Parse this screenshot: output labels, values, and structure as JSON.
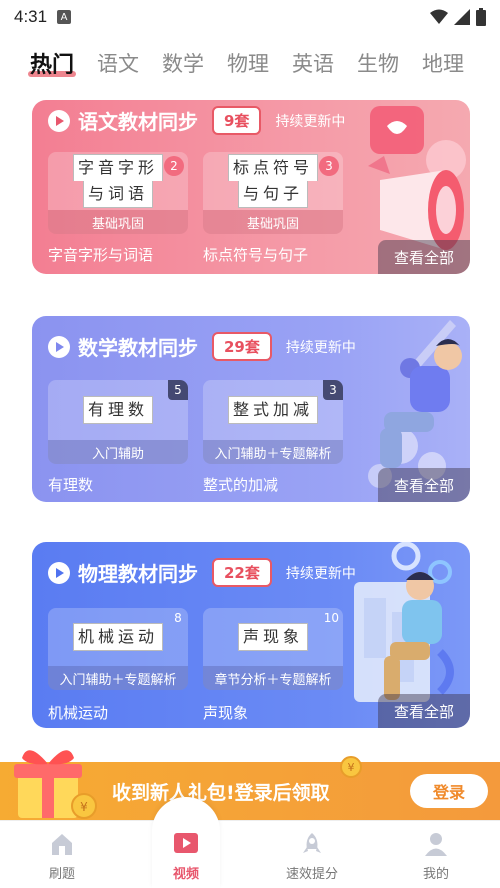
{
  "status_bar": {
    "time": "4:31",
    "notif_letter": "A"
  },
  "tabs": [
    {
      "label": "热门",
      "active": true
    },
    {
      "label": "语文",
      "active": false
    },
    {
      "label": "数学",
      "active": false
    },
    {
      "label": "物理",
      "active": false
    },
    {
      "label": "英语",
      "active": false
    },
    {
      "label": "生物",
      "active": false
    },
    {
      "label": "地理",
      "active": false
    }
  ],
  "cards": [
    {
      "title": "语文教材同步",
      "count": "9套",
      "status": "持续更新中",
      "view_all": "查看全部",
      "items": [
        {
          "thumb_title_line1": "字音字形",
          "thumb_title_line2": "与词语",
          "num": "2",
          "foot": "基础巩固",
          "label": "字音字形与词语"
        },
        {
          "thumb_title_line1": "标点符号",
          "thumb_title_line2": "与句子",
          "num": "3",
          "foot": "基础巩固",
          "label": "标点符号与句子"
        }
      ]
    },
    {
      "title": "数学教材同步",
      "count": "29套",
      "status": "持续更新中",
      "view_all": "查看全部",
      "items": [
        {
          "thumb_title": "有理数",
          "num": "5",
          "foot": "入门辅助",
          "label": "有理数"
        },
        {
          "thumb_title": "整式加减",
          "num": "3",
          "foot": "入门辅助＋专题解析",
          "label": "整式的加减"
        }
      ]
    },
    {
      "title": "物理教材同步",
      "count": "22套",
      "status": "持续更新中",
      "view_all": "查看全部",
      "items": [
        {
          "thumb_title": "机械运动",
          "num": "8",
          "foot": "入门辅助＋专题解析",
          "label": "机械运动"
        },
        {
          "thumb_title": "声现象",
          "num": "10",
          "foot": "章节分析＋专题解析",
          "label": "声现象"
        }
      ]
    }
  ],
  "banner": {
    "text": "收到新人礼包!登录后领取",
    "login": "登录"
  },
  "bottom_nav": [
    {
      "label": "刷题",
      "icon": "house-icon",
      "active": false
    },
    {
      "label": "视频",
      "icon": "video-icon",
      "active": true
    },
    {
      "label": "速效提分",
      "icon": "rocket-icon",
      "active": false
    },
    {
      "label": "我的",
      "icon": "person-icon",
      "active": false
    }
  ],
  "colors": {
    "accent": "#e8576d",
    "pink_card": "#f37e92",
    "purple_card": "#8b93f0",
    "blue_card": "#5a7cf2",
    "banner": "#f6ab33"
  }
}
